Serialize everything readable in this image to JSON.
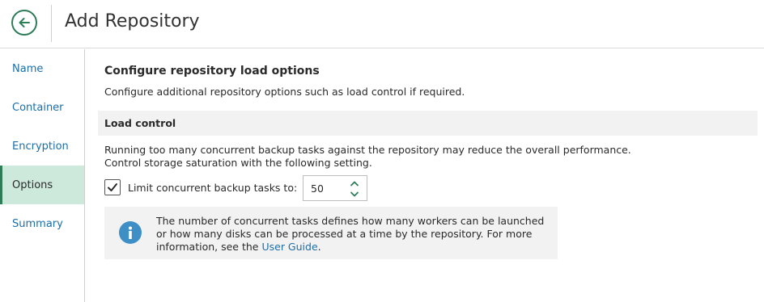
{
  "header": {
    "title": "Add Repository"
  },
  "sidebar": {
    "items": [
      {
        "label": "Name"
      },
      {
        "label": "Container"
      },
      {
        "label": "Encryption"
      },
      {
        "label": "Options",
        "active": true
      },
      {
        "label": "Summary"
      }
    ]
  },
  "main": {
    "title": "Configure repository load options",
    "description": "Configure additional repository options such as load control if required.",
    "load_control": {
      "header": "Load control",
      "description": "Running too many concurrent backup tasks against the repository may reduce the overall performance. Control storage saturation with the following setting.",
      "checkbox_label": "Limit concurrent backup tasks to:",
      "checkbox_checked": true,
      "task_limit": "50"
    },
    "info": {
      "text_before": "The number of concurrent tasks defines how many workers can be launched or how many disks can be processed at a time by the repository. For more information, see the",
      "link": "User Guide",
      "text_after": "."
    }
  },
  "colors": {
    "accent": "#2e7d59",
    "active_nav_bg": "#cde9dc",
    "link": "#1b6fa8",
    "info_icon": "#3d8fc6",
    "panel_bg": "#f2f2f2"
  },
  "icons": {
    "back": "arrow-left-circle-icon",
    "check": "checkmark-icon",
    "info": "info-icon",
    "up": "chevron-up-icon",
    "down": "chevron-down-icon"
  }
}
